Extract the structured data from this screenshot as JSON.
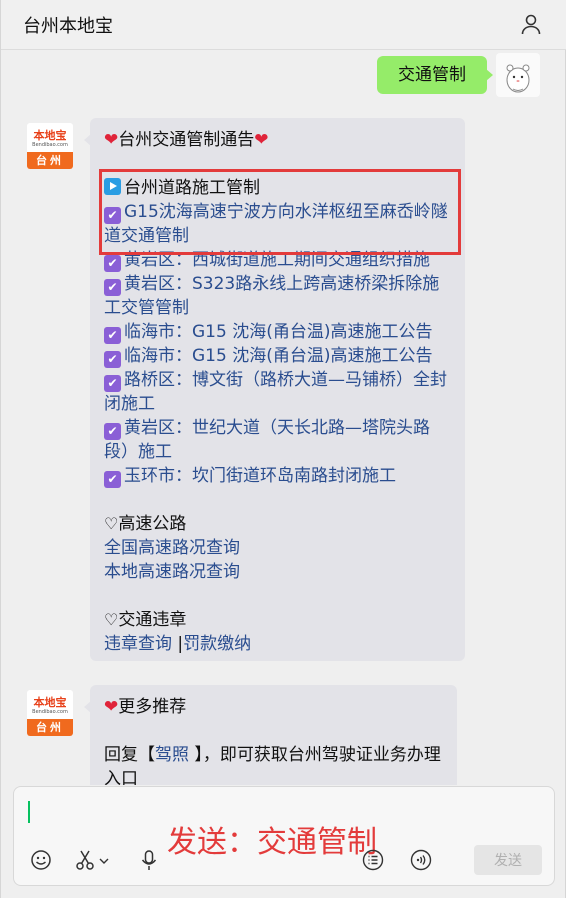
{
  "header": {
    "title": "台州本地宝"
  },
  "outgoing": {
    "text": "交通管制"
  },
  "bot": {
    "logo_main": "本地宝",
    "logo_sub": "Bendibao.com",
    "logo_city": "台州"
  },
  "message1": {
    "title": "台州交通管制通告",
    "section_heading": "台州道路施工管制",
    "items": [
      "G15沈海高速宁波方向水洋枢纽至麻岙岭隧道交通管制",
      "黄岩区：西城街道施工期间交通组织措施",
      "黄岩区：S323路永线上跨高速桥梁拆除施工交管管制",
      "临海市：G15 沈海(甬台温)高速施工公告",
      "临海市：G15 沈海(甬台温)高速施工公告",
      "路桥区：博文街（路桥大道—马铺桥）全封闭施工",
      "黄岩区：世纪大道（天长北路—塔院头路段）施工",
      "玉环市：坎门街道环岛南路封闭施工"
    ],
    "highway": {
      "heading": "高速公路",
      "links": [
        "全国高速路况查询",
        "本地高速路况查询"
      ]
    },
    "violation": {
      "heading": "交通违章",
      "link1": "违章查询",
      "separator": "|",
      "link2": "罚款缴纳"
    }
  },
  "message2": {
    "title": "更多推荐",
    "text_before": "回复【",
    "keyword": "驾照",
    "text_after": " 】，即可获取台州驾驶证业务办理入口"
  },
  "composer": {
    "annotation": "发送：交通管制",
    "send_label": "发送"
  },
  "colors": {
    "accent_green": "#95ec69",
    "highlight_red": "#e33b3b",
    "link_blue": "#2a4d8f"
  }
}
